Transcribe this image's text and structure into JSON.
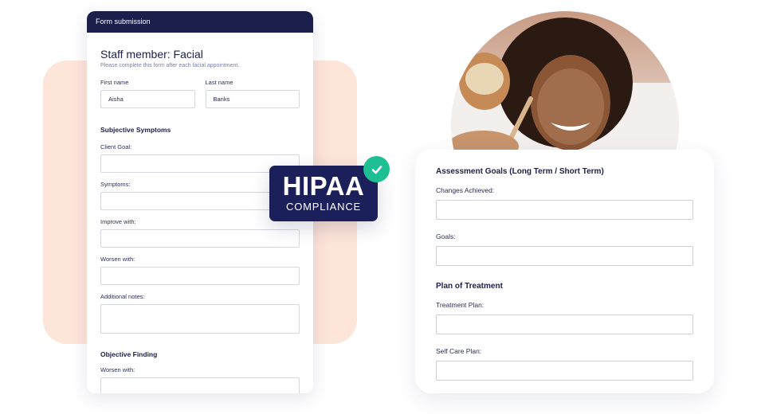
{
  "form": {
    "header": "Form submission",
    "title": "Staff member: Facial",
    "subtitle": "Please complete this form after each facial appointment.",
    "first_name": {
      "label": "First name",
      "value": "Aisha"
    },
    "last_name": {
      "label": "Last name",
      "value": "Banks"
    },
    "sections": {
      "subjective": "Subjective Symptoms",
      "objective": "Objective Finding"
    },
    "fields": {
      "client_goal": "Client Goal:",
      "symptoms": "Symptoms:",
      "improve_with": "Improve with:",
      "worsen_with": "Worsen with:",
      "additional_notes": "Additional notes:",
      "objective_worsen_with": "Worsen with:"
    }
  },
  "badge": {
    "title": "HIPAA",
    "subtitle": "COMPLIANCE",
    "icon": "check-icon",
    "color": "#1b1f5a",
    "check_color": "#1fbf94"
  },
  "assessment": {
    "section1": "Assessment Goals (Long Term / Short Term)",
    "changes_achieved": "Changes Achieved:",
    "goals": "Goals:",
    "section2": "Plan of Treatment",
    "treatment_plan": "Treatment Plan:",
    "self_care_plan": "Self Care Plan:"
  },
  "colors": {
    "navy": "#1b1f4b",
    "peach": "#fde5d9"
  }
}
